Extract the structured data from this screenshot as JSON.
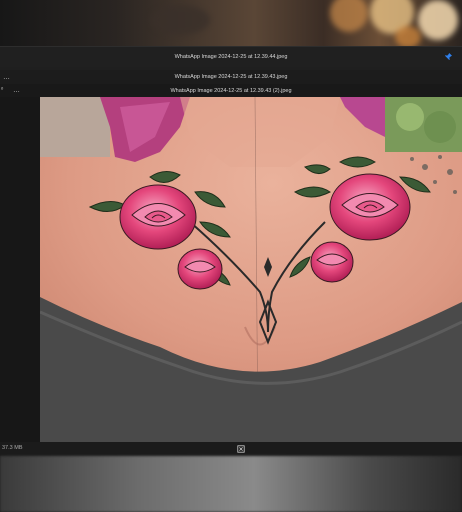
{
  "windows": [
    {
      "title": "WhatsApp Image 2024-12-25 at 12.39.44.jpeg"
    },
    {
      "title": "WhatsApp Image 2024-12-25 at 12.39.43.jpeg"
    },
    {
      "title": "WhatsApp Image 2024-12-25 at 12.39.43 (2).jpeg"
    }
  ],
  "menu_glyph": "…",
  "status": {
    "file_size": "37.3 MB"
  },
  "icons": {
    "pin": "pin-icon",
    "fit": "fit-to-window-icon",
    "more": "more-options-icon"
  },
  "colors": {
    "titlebar": "#202020",
    "accent": "#2f80ed"
  }
}
